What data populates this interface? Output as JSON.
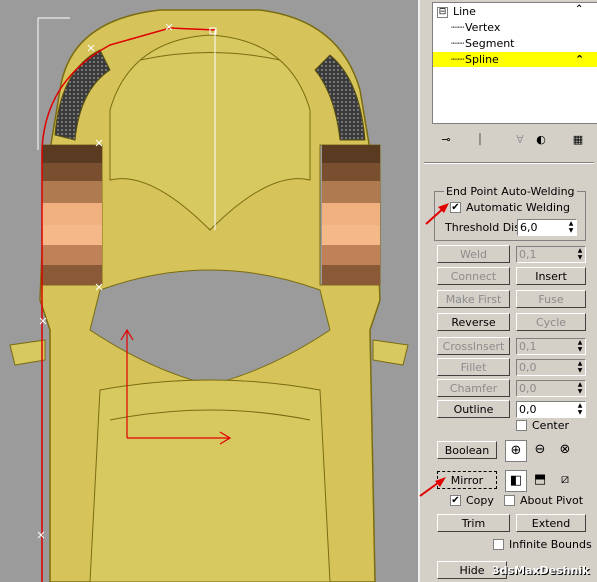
{
  "modifier_stack": {
    "items": [
      {
        "label": "Line",
        "toggle": "⊟"
      },
      {
        "label": "Vertex"
      },
      {
        "label": "Segment"
      },
      {
        "label": "Spline"
      }
    ]
  },
  "toolbar_icons": [
    "pin-stack-icon",
    "show-end-result-icon",
    "make-unique-icon",
    "remove-modifier-icon",
    "configure-sets-icon"
  ],
  "auto_welding": {
    "group_label": "End Point Auto-Welding",
    "automatic_welding_label": "Automatic Welding",
    "automatic_welding_checked": true,
    "threshold_label": "Threshold Dist.",
    "threshold_value": "6,0"
  },
  "buttons": {
    "weld": "Weld",
    "weld_value": "0,1",
    "connect": "Connect",
    "insert": "Insert",
    "make_first": "Make First",
    "fuse": "Fuse",
    "reverse": "Reverse",
    "cycle": "Cycle",
    "crossinsert": "CrossInsert",
    "crossinsert_value": "0,1",
    "fillet": "Fillet",
    "fillet_value": "0,0",
    "chamfer": "Chamfer",
    "chamfer_value": "0,0",
    "outline": "Outline",
    "outline_value": "0,0",
    "center_label": "Center",
    "boolean": "Boolean",
    "mirror": "Mirror",
    "copy_label": "Copy",
    "copy_checked": true,
    "about_pivot_label": "About Pivot",
    "trim": "Trim",
    "extend": "Extend",
    "infinite_bounds_label": "Infinite Bounds",
    "hide": "Hide"
  },
  "watermark": "3dsMaxDeshnik",
  "colors": {
    "car_body": "#d8c860",
    "wireframe": "#8a7a10",
    "spline_red": "#e00000",
    "selection_yellow": "#ffff00"
  }
}
